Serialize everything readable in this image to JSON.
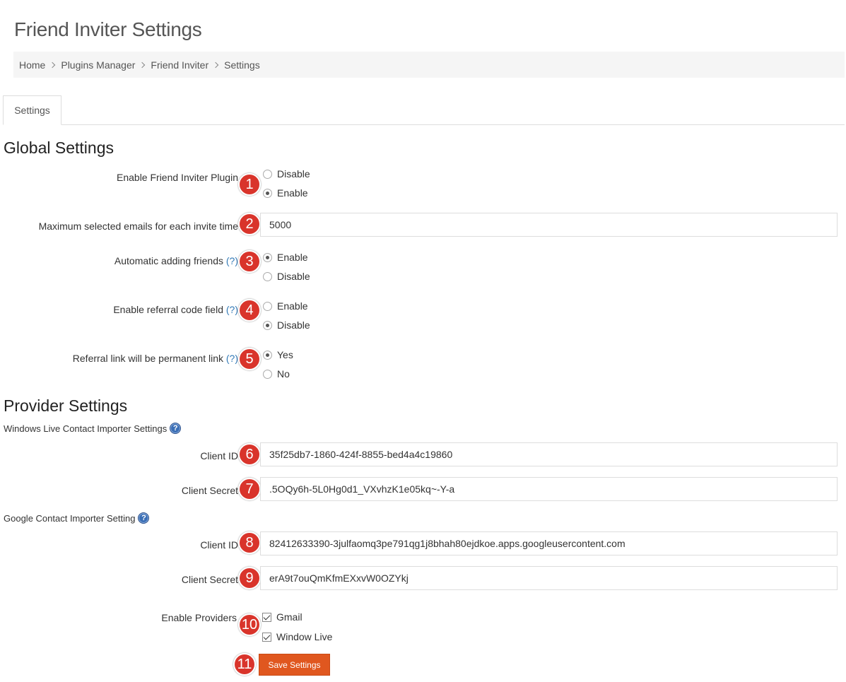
{
  "page": {
    "title": "Friend Inviter Settings"
  },
  "breadcrumb": [
    "Home",
    "Plugins Manager",
    "Friend Inviter",
    "Settings"
  ],
  "tabs": [
    {
      "label": "Settings",
      "active": true
    }
  ],
  "global": {
    "title": "Global Settings",
    "enable_plugin": {
      "label": "Enable Friend Inviter Plugin",
      "options": [
        "Disable",
        "Enable"
      ],
      "selected": "Enable"
    },
    "max_emails": {
      "label": "Maximum selected emails for each invite time",
      "value": "5000"
    },
    "auto_friends": {
      "label": "Automatic adding friends",
      "help": "(?)",
      "options": [
        "Enable",
        "Disable"
      ],
      "selected": "Enable"
    },
    "referral_field": {
      "label": "Enable referral code field",
      "help": "(?)",
      "options": [
        "Enable",
        "Disable"
      ],
      "selected": "Disable"
    },
    "permanent_link": {
      "label": "Referral link will be permanent link",
      "help": "(?)",
      "options": [
        "Yes",
        "No"
      ],
      "selected": "Yes"
    }
  },
  "provider": {
    "title": "Provider Settings",
    "windows_live": {
      "title": "Windows Live Contact Importer Settings",
      "client_id_label": "Client ID",
      "client_id": "35f25db7-1860-424f-8855-bed4a4c19860",
      "client_secret_label": "Client Secret",
      "client_secret": ".5OQy6h-5L0Hg0d1_VXvhzK1e05kq~-Y-a"
    },
    "google": {
      "title": "Google Contact Importer Setting",
      "client_id_label": "Client ID",
      "client_id": "82412633390-3julfaomq3pe791qg1j8bhah80ejdkoe.apps.googleusercontent.com",
      "client_secret_label": "Client Secret",
      "client_secret": "erA9t7ouQmKfmEXxvW0OZYkj"
    },
    "enable_providers": {
      "label": "Enable Providers",
      "options": [
        {
          "label": "Gmail",
          "checked": true
        },
        {
          "label": "Window Live",
          "checked": true
        }
      ]
    }
  },
  "save_button": {
    "label": "Save Settings"
  },
  "badges": [
    "1",
    "2",
    "3",
    "4",
    "5",
    "6",
    "7",
    "8",
    "9",
    "10",
    "11"
  ],
  "colors": {
    "badge": "#d9342b",
    "button": "#e0571f",
    "link": "#337ab7",
    "help_icon": "#3b6fb6"
  }
}
